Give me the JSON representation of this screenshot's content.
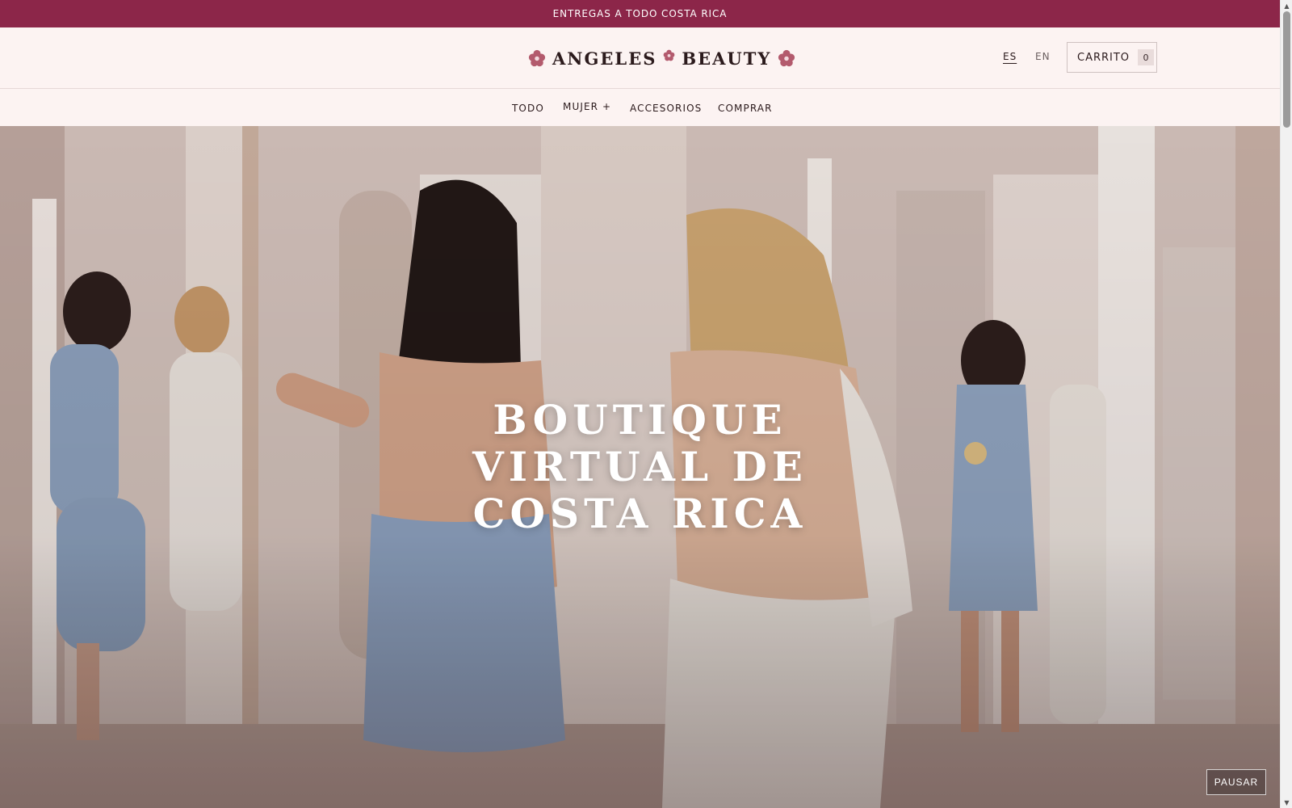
{
  "colors": {
    "brand": "#8c2649",
    "flower": "#b35a6d"
  },
  "announcement": {
    "text": "ENTREGAS A TODO COSTA RICA"
  },
  "header": {
    "logo_left": "ANGELES",
    "logo_right": "BEAUTY",
    "languages": [
      {
        "label": "ES",
        "active": true
      },
      {
        "label": "EN",
        "active": false
      }
    ],
    "cart": {
      "label": "CARRITO",
      "count": "0"
    }
  },
  "nav": {
    "items": [
      {
        "label": "TODO"
      },
      {
        "label": "MUJER +"
      },
      {
        "label": "ACCESORIOS"
      },
      {
        "label": "COMPRAR"
      }
    ]
  },
  "hero": {
    "title_lines": [
      "BOUTIQUE",
      "VIRTUAL DE",
      "COSTA RICA"
    ],
    "pause_label": "PAUSAR"
  },
  "icons": {
    "logo": "flower-icon",
    "scroll_up": "scroll-up-arrow-icon",
    "scroll_down": "scroll-down-arrow-icon"
  }
}
